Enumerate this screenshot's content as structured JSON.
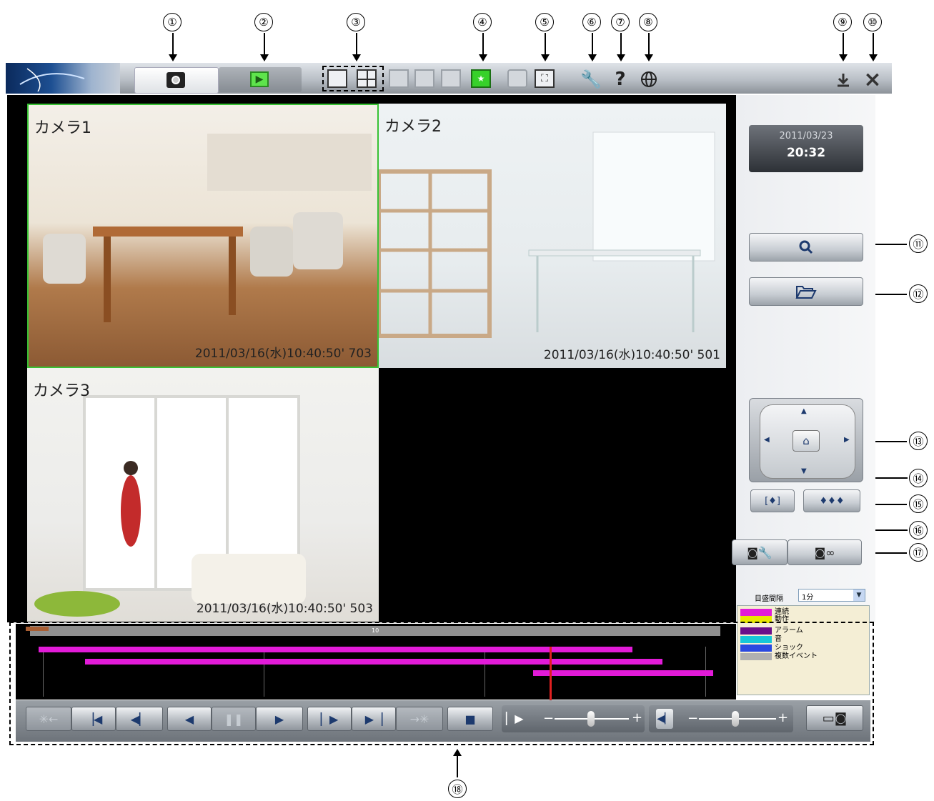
{
  "callouts": [
    "①",
    "②",
    "③",
    "④",
    "⑤",
    "⑥",
    "⑦",
    "⑧",
    "⑨",
    "⑩",
    "⑪",
    "⑫",
    "⑬",
    "⑭",
    "⑮",
    "⑯",
    "⑰",
    "⑱"
  ],
  "toolbar": {
    "icons": {
      "live": "camera-lens-icon",
      "playback": "play-icon",
      "help": "?",
      "settings": "wrench-icon",
      "language": "globe-icon",
      "minimize": "download-icon",
      "close": "×"
    }
  },
  "datetime": {
    "date": "2011/03/23",
    "time": "20:32"
  },
  "cameras": [
    {
      "label": "カメラ1",
      "timestamp": "2011/03/16(水)10:40:50' 703"
    },
    {
      "label": "カメラ2",
      "timestamp": "2011/03/16(水)10:40:50' 501"
    },
    {
      "label": "カメラ3",
      "timestamp": "2011/03/16(水)10:40:50' 503"
    }
  ],
  "timeline": {
    "scale_label": "目盛間隔",
    "scale_value": "1分",
    "ruler_mark": "10",
    "legend": [
      "連続",
      "動作",
      "アラーム",
      "音",
      "ショック",
      "複数イベント"
    ],
    "legend_colors": [
      "#e21bd8",
      "#e8e800",
      "#6a0f8a",
      "#17c7d8",
      "#2a49e0",
      "#b0b0b0"
    ]
  },
  "controls": {
    "speed_minus": "−",
    "speed_plus": "+",
    "volume_minus": "−",
    "volume_plus": "+"
  }
}
